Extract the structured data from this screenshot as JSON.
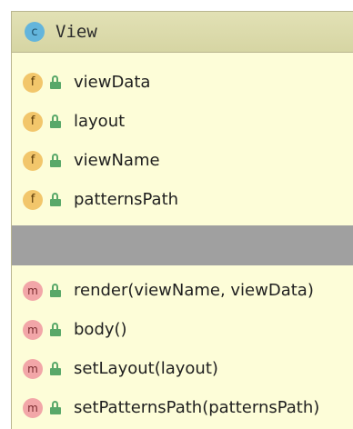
{
  "class_header": {
    "icon_letter": "c",
    "name": "View"
  },
  "fields": [
    {
      "badge": "f",
      "name": "viewData"
    },
    {
      "badge": "f",
      "name": "layout"
    },
    {
      "badge": "f",
      "name": "viewName"
    },
    {
      "badge": "f",
      "name": "patternsPath"
    }
  ],
  "methods": [
    {
      "badge": "m",
      "name": "render(viewName, viewData)"
    },
    {
      "badge": "m",
      "name": "body()"
    },
    {
      "badge": "m",
      "name": "setLayout(layout)"
    },
    {
      "badge": "m",
      "name": "setPatternsPath(patternsPath)"
    }
  ],
  "colors": {
    "box_background": "#fdfdd8",
    "header_background": "#d6d5a3",
    "class_icon": "#63b5dc",
    "field_badge": "#f2c66b",
    "method_badge": "#f2a6a8",
    "lock": "#59a869",
    "divider": "#a0a0a0"
  },
  "icons": {
    "class": "class-icon",
    "field": "field-icon",
    "method": "method-icon",
    "visibility": "lock-icon"
  }
}
